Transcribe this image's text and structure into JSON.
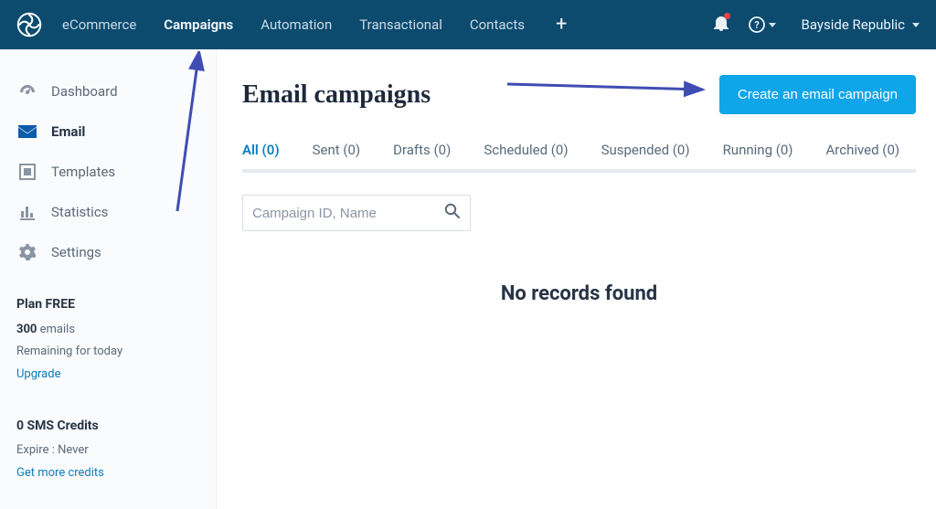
{
  "top": {
    "items": [
      "eCommerce",
      "Campaigns",
      "Automation",
      "Transactional",
      "Contacts"
    ],
    "activeIndex": 1,
    "account": "Bayside Republic"
  },
  "sidebar": {
    "items": [
      {
        "label": "Dashboard"
      },
      {
        "label": "Email"
      },
      {
        "label": "Templates"
      },
      {
        "label": "Statistics"
      },
      {
        "label": "Settings"
      }
    ],
    "activeIndex": 1,
    "plan": {
      "title": "Plan FREE",
      "qty": "300",
      "unit": "emails",
      "remaining": "Remaining for today",
      "upgrade": "Upgrade"
    },
    "sms": {
      "title": "0 SMS Credits",
      "expire": "Expire : Never",
      "more": "Get more credits"
    }
  },
  "page": {
    "title": "Email campaigns",
    "create": "Create an email campaign",
    "tabs": [
      "All (0)",
      "Sent (0)",
      "Drafts (0)",
      "Scheduled (0)",
      "Suspended (0)",
      "Running (0)",
      "Archived (0)"
    ],
    "activeTab": 0,
    "search_placeholder": "Campaign ID, Name",
    "empty": "No records found"
  }
}
